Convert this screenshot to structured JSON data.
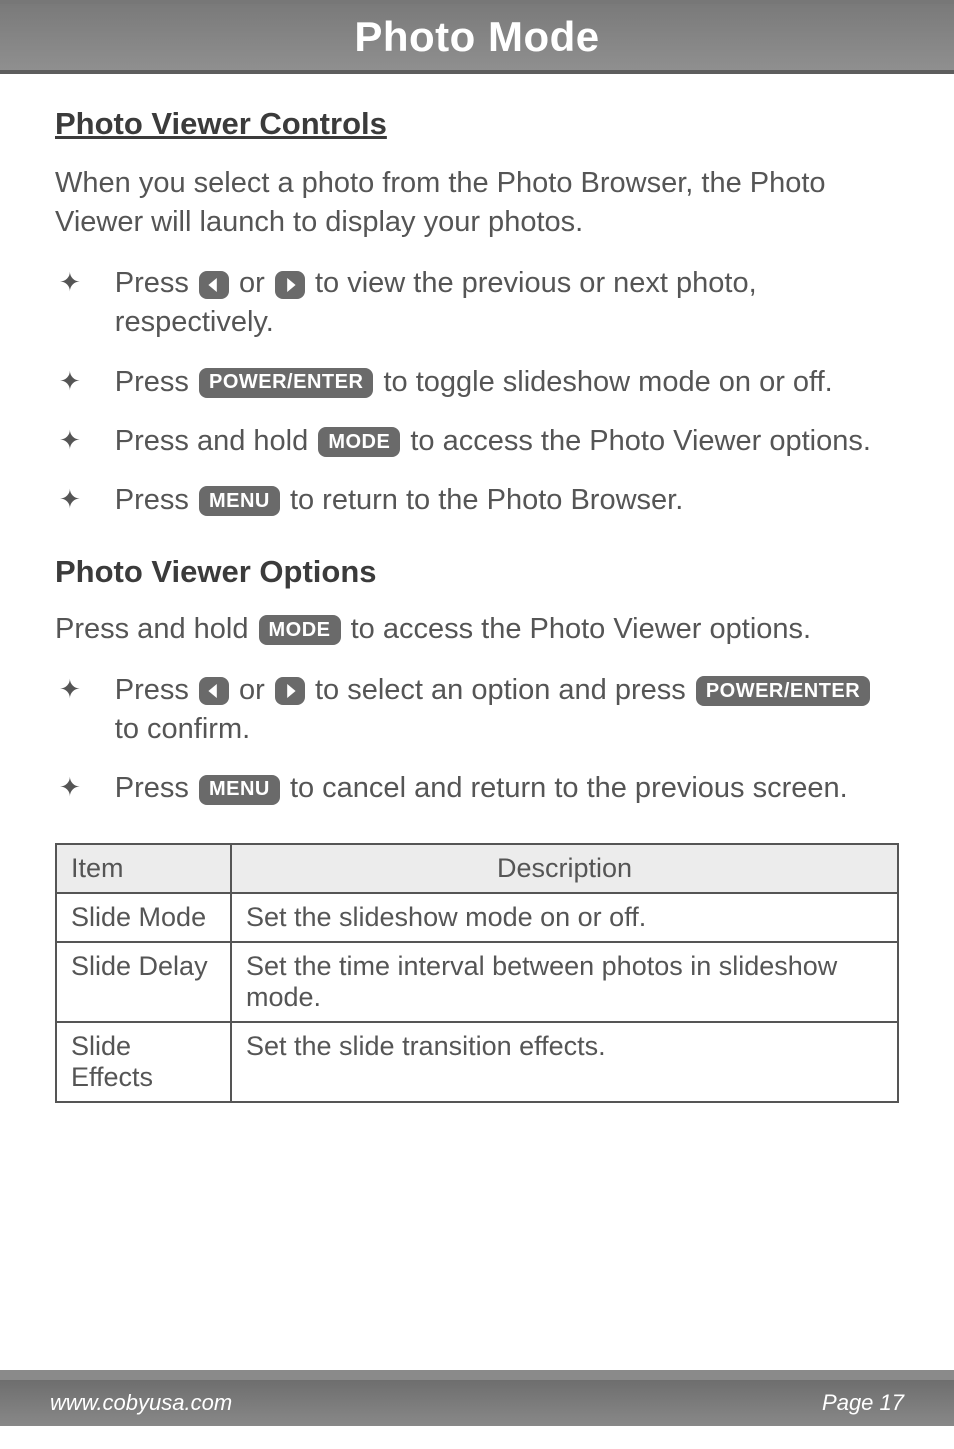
{
  "header": {
    "title": "Photo Mode"
  },
  "section1": {
    "title": "Photo Viewer Controls",
    "intro": "When you select a photo from the Photo Browser, the Photo Viewer will launch to display your photos.",
    "b1a": "Press ",
    "b1b": " or ",
    "b1c": " to view the previous or next photo, respectively.",
    "b2a": "Press ",
    "b2b": " to toggle slideshow mode on or off.",
    "b3a": "Press and hold ",
    "b3b": " to access the Photo Viewer options.",
    "b4a": "Press ",
    "b4b": " to return to the Photo Browser."
  },
  "section2": {
    "title": "Photo Viewer Options",
    "intro_a": "Press and hold ",
    "intro_b": " to access the Photo Viewer options.",
    "b1a": "Press ",
    "b1b": " or ",
    "b1c": " to select an option and press ",
    "b1d": " to confirm.",
    "b2a": "Press ",
    "b2b": " to cancel and return to the previous screen."
  },
  "keys": {
    "power_enter": "POWER/ENTER",
    "mode": "MODE",
    "menu": "MENU"
  },
  "table": {
    "h_item": "Item",
    "h_desc": "Description",
    "r1_item": "Slide Mode",
    "r1_desc": "Set the slideshow mode on or off.",
    "r2_item": "Slide Delay",
    "r2_desc": "Set the time interval between photos in slideshow mode.",
    "r3_item": "Slide Effects",
    "r3_desc": "Set the slide transition effects."
  },
  "footer": {
    "url": "www.cobyusa.com",
    "page": "Page 17"
  }
}
